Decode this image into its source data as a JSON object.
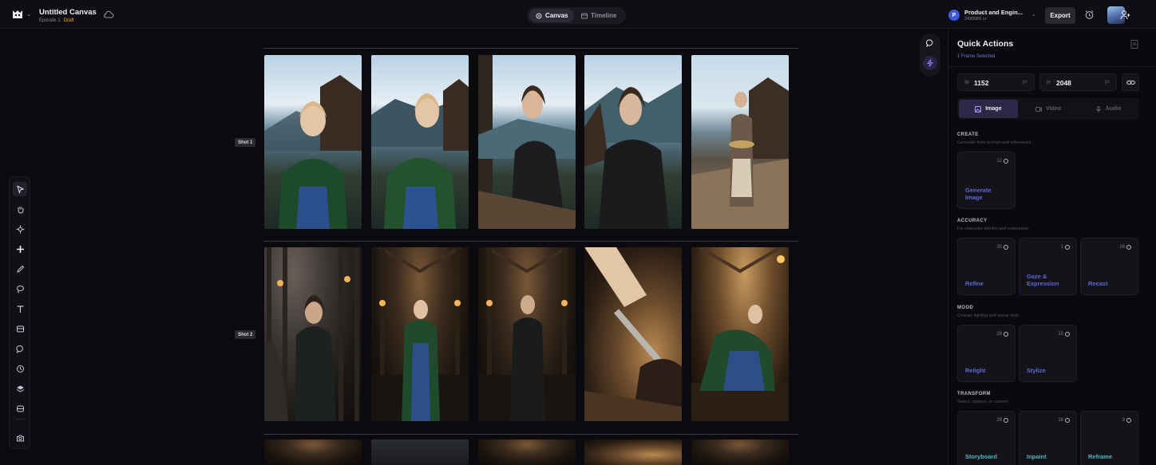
{
  "header": {
    "title": "Untitled Canvas",
    "episode": "Episode 1",
    "status": "Draft",
    "view_tabs": [
      {
        "label": "Canvas"
      },
      {
        "label": "Timeline"
      }
    ],
    "active_view": "Canvas",
    "workspace": {
      "initial": "P",
      "name": "Product and Engin...",
      "id": "2499985 cr"
    },
    "export_label": "Export"
  },
  "toolbar": {
    "tools": [
      "select",
      "hand",
      "anchor",
      "add",
      "pen",
      "lasso",
      "text",
      "frame",
      "shape",
      "history",
      "layers",
      "stack",
      "capture"
    ],
    "active_tool": "select"
  },
  "canvas": {
    "shots": [
      {
        "label": "Shot 1",
        "frames": 5
      },
      {
        "label": "Shot 2",
        "frames": 5
      }
    ]
  },
  "quick_actions": {
    "title": "Quick Actions",
    "selection": "1 Frame Selected",
    "width_label": "W",
    "width": "1152",
    "height_label": "H",
    "height": "2048",
    "unit": "px",
    "media_tabs": [
      {
        "label": "Image"
      },
      {
        "label": "Video"
      },
      {
        "label": "Audio"
      }
    ],
    "active_media": "Image",
    "sections": {
      "create": {
        "title": "CREATE",
        "desc": "Generate from prompt and references",
        "cards": [
          {
            "cost": "12",
            "label": "Generate Image"
          }
        ]
      },
      "accuracy": {
        "title": "ACCURACY",
        "desc": "Fix character identity and expression",
        "cards": [
          {
            "cost": "30",
            "label": "Refine"
          },
          {
            "cost": "1",
            "label": "Gaze & Expression"
          },
          {
            "cost": "26",
            "label": "Recast"
          }
        ]
      },
      "mood": {
        "title": "MOOD",
        "desc": "Change lighting and visual style",
        "cards": [
          {
            "cost": "28",
            "label": "Relight"
          },
          {
            "cost": "15",
            "label": "Stylize"
          }
        ]
      },
      "transform": {
        "title": "TRANSFORM",
        "desc": "Select, replace, or convert",
        "cards": [
          {
            "cost": "28",
            "label": "Storyboard"
          },
          {
            "cost": "16",
            "label": "Inpaint"
          },
          {
            "cost": "9",
            "label": "Reframe"
          }
        ]
      }
    }
  }
}
